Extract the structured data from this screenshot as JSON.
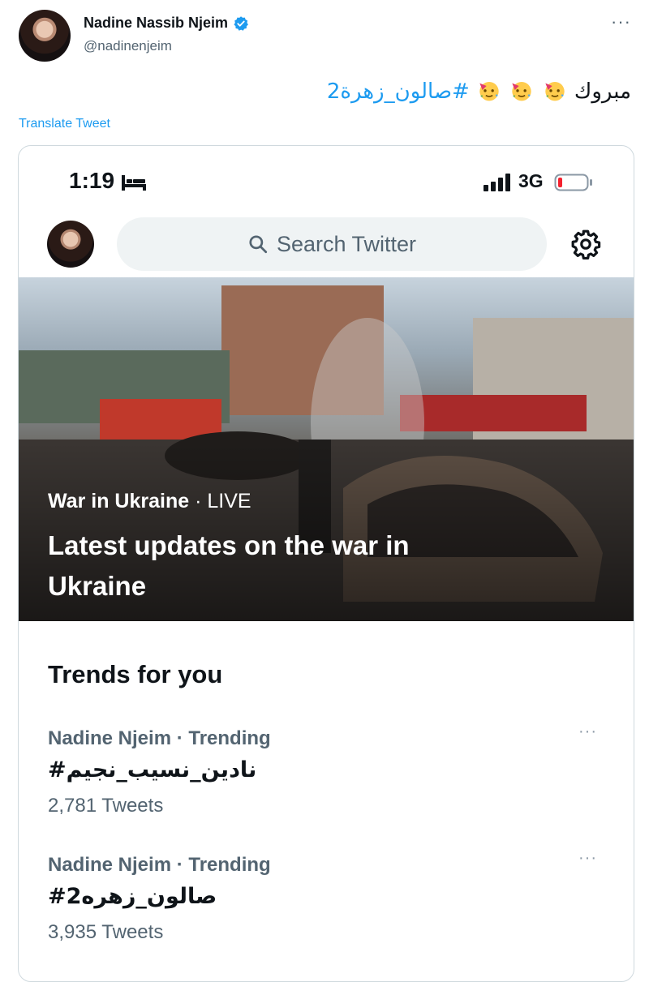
{
  "author": {
    "display_name": "Nadine Nassib Njeim",
    "handle": "@nadinenjeim",
    "verified": true
  },
  "tweet": {
    "text_word": "مبروك",
    "emoji_count": 3,
    "emoji_name": "partying-face",
    "hashtag": "#صالون_زهرة2",
    "translate_label": "Translate Tweet",
    "more_label": "···"
  },
  "screenshot": {
    "status_bar": {
      "time": "1:19",
      "network": "3G"
    },
    "search": {
      "placeholder": "Search Twitter"
    },
    "hero": {
      "topic": "War in Ukraine",
      "separator": " · ",
      "badge": "LIVE",
      "title": "Latest updates on the war in Ukraine"
    },
    "trends": {
      "heading": "Trends for you",
      "items": [
        {
          "context": "Nadine Njeim · Trending",
          "name": "#نادين_نسيب_نجيم",
          "count": "2,781 Tweets"
        },
        {
          "context": "Nadine Njeim · Trending",
          "name": "#صالون_زهره2",
          "count": "3,935 Tweets"
        }
      ]
    }
  },
  "colors": {
    "accent": "#1d9bf0",
    "muted": "#536471",
    "search_bg": "#eff3f4",
    "battery_low": "#f4212e"
  }
}
